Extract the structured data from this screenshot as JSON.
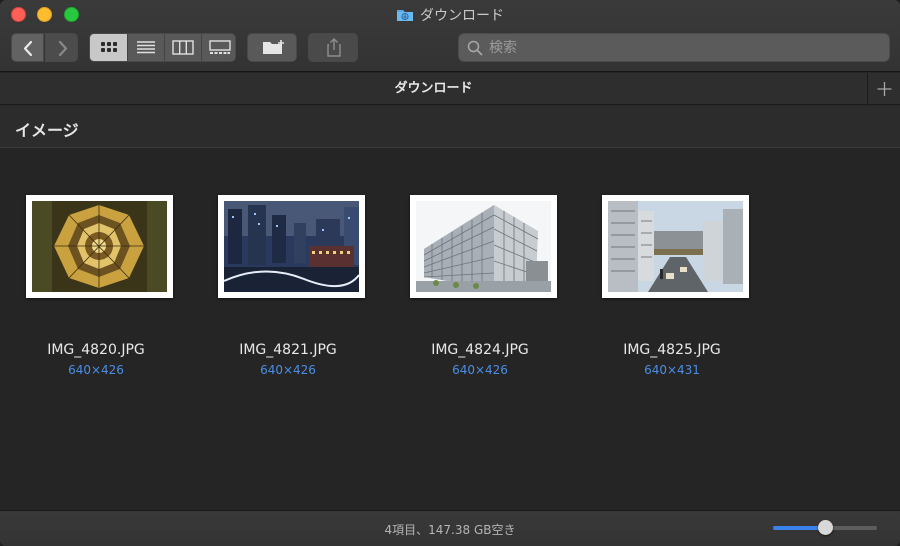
{
  "window": {
    "title": "ダウンロード",
    "accent_color": "#3b82f0"
  },
  "toolbar": {
    "back_icon": "chevron-left-icon",
    "forward_icon": "chevron-right-icon",
    "views": [
      "icon-view",
      "list-view",
      "column-view",
      "gallery-view"
    ],
    "active_view": "icon-view",
    "new_folder_icon": "new-folder-icon",
    "share_icon": "share-icon"
  },
  "search": {
    "placeholder": "検索",
    "value": ""
  },
  "tabs": [
    {
      "label": "ダウンロード"
    }
  ],
  "section": {
    "title": "イメージ"
  },
  "items": [
    {
      "name": "IMG_4820.JPG",
      "dimensions": "640×426"
    },
    {
      "name": "IMG_4821.JPG",
      "dimensions": "640×426"
    },
    {
      "name": "IMG_4824.JPG",
      "dimensions": "640×426"
    },
    {
      "name": "IMG_4825.JPG",
      "dimensions": "640×431"
    }
  ],
  "status": {
    "text": "4項目、147.38 GB空き",
    "icon_size_level": 0.5
  }
}
